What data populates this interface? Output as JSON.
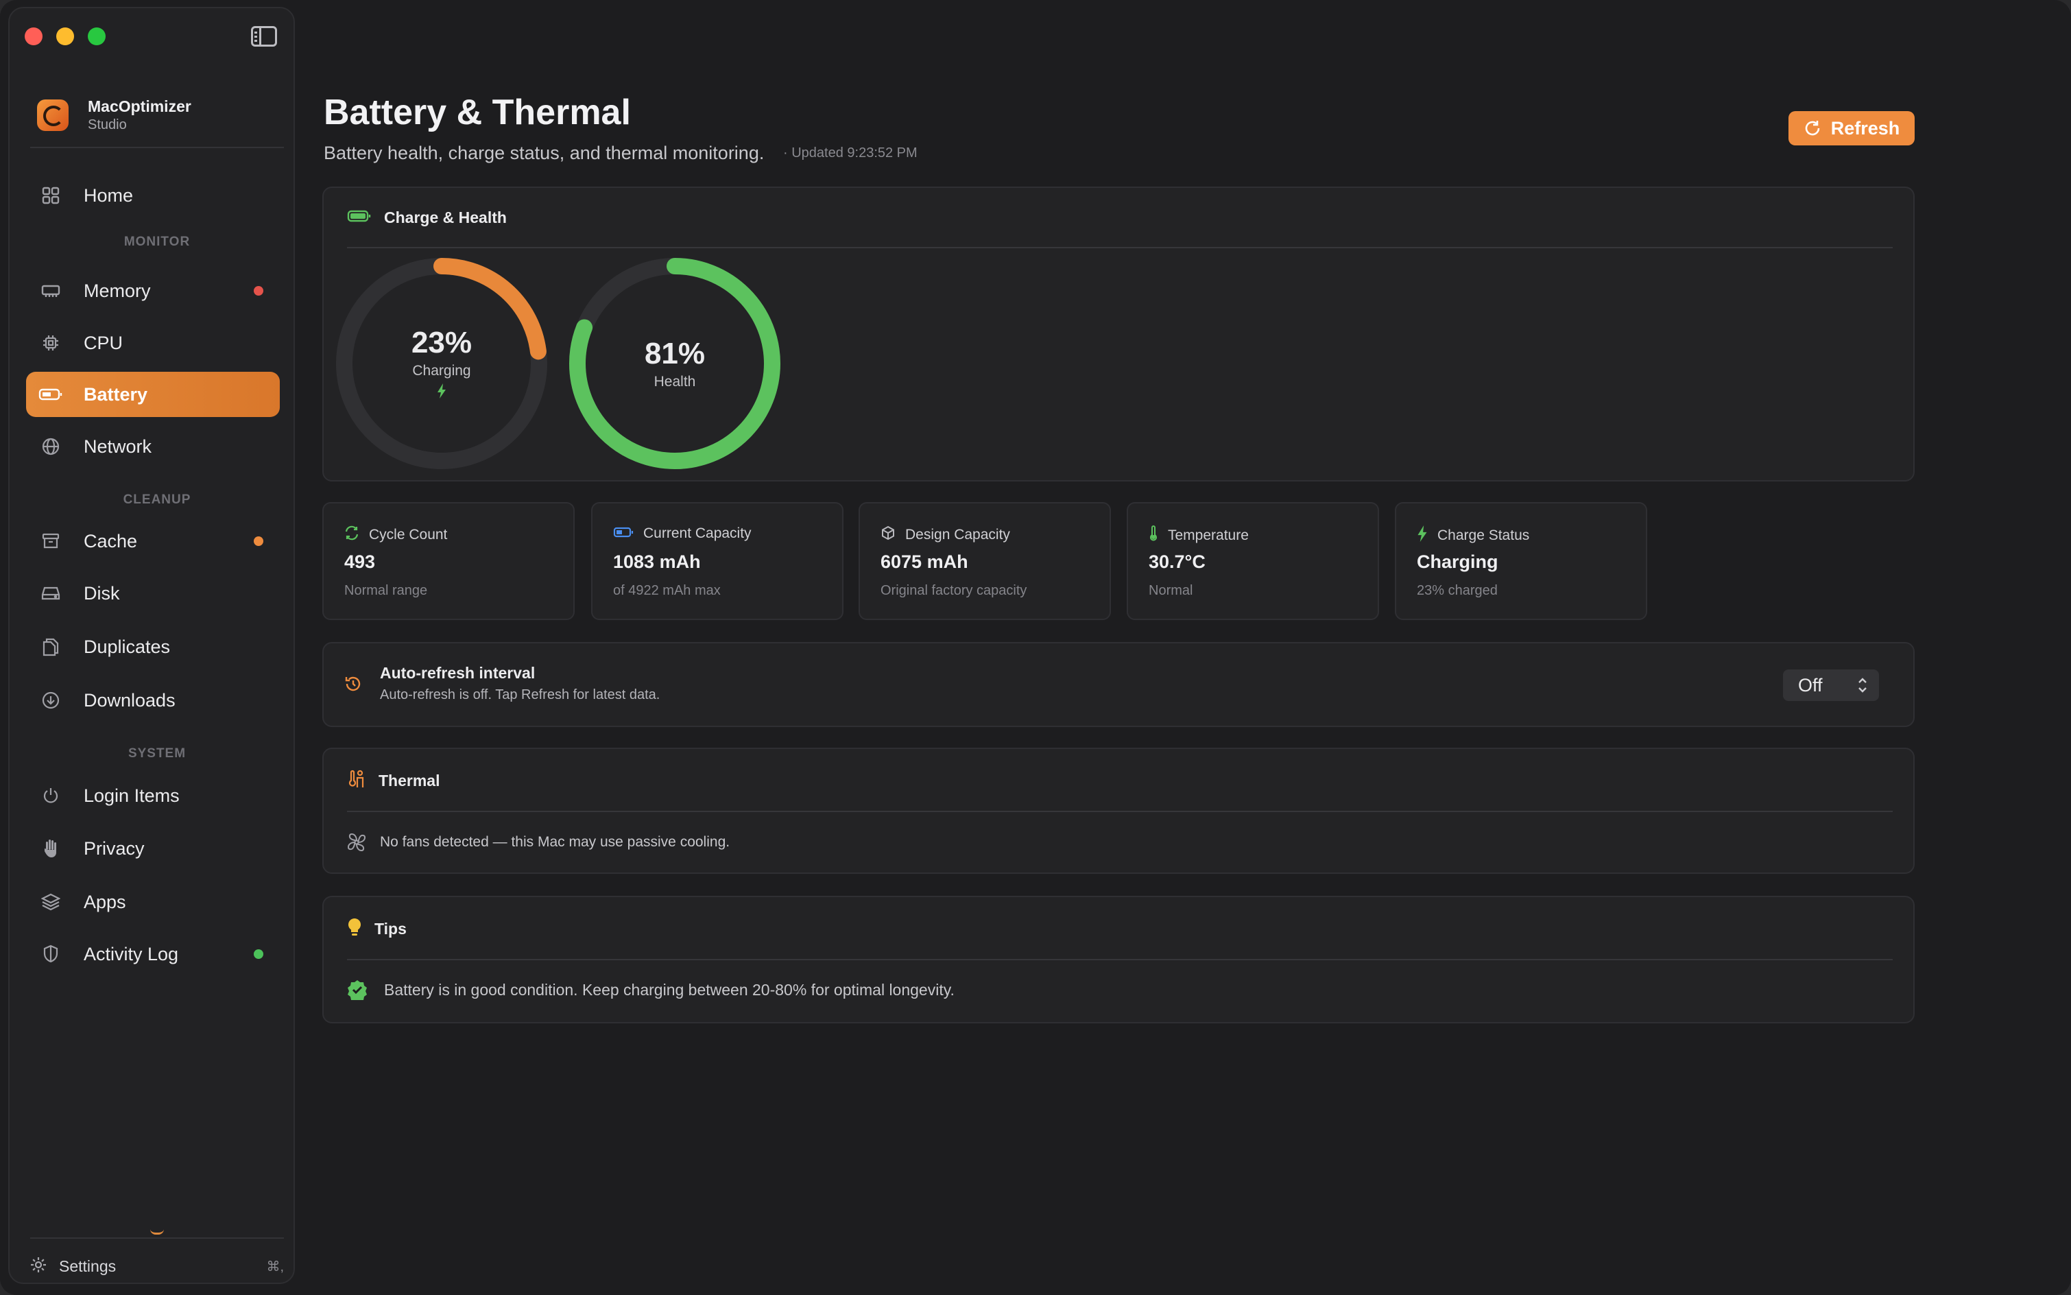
{
  "app": {
    "name": "MacOptimizer",
    "edition": "Studio"
  },
  "sidebar": {
    "home": "Home",
    "sections": {
      "monitor": "MONITOR",
      "cleanup": "CLEANUP",
      "system": "SYSTEM"
    },
    "items": {
      "memory": "Memory",
      "cpu": "CPU",
      "battery": "Battery",
      "network": "Network",
      "cache": "Cache",
      "disk": "Disk",
      "duplicates": "Duplicates",
      "downloads": "Downloads",
      "login_items": "Login Items",
      "privacy": "Privacy",
      "apps": "Apps",
      "activity_log": "Activity Log"
    },
    "active_item": "Battery",
    "settings_label": "Settings",
    "settings_shortcut": "⌘,",
    "status_colors": {
      "memory": "#e5534b",
      "cache": "#ef8c3e",
      "activity_log": "#4cc25a"
    }
  },
  "header": {
    "title": "Battery & Thermal",
    "subtitle": "Battery health, charge status, and thermal monitoring.",
    "updated": "· Updated 9:23:52 PM",
    "refresh_label": "Refresh"
  },
  "charge_health": {
    "title": "Charge & Health",
    "charge": {
      "percent_label": "23%",
      "value": 0.23,
      "label": "Charging",
      "color": "#e8883a"
    },
    "health": {
      "percent_label": "81%",
      "value": 0.81,
      "label": "Health",
      "color": "#5cc25e"
    }
  },
  "stats": [
    {
      "icon": "refresh-cycle-icon",
      "title": "Cycle Count",
      "value": "493",
      "note": "Normal range"
    },
    {
      "icon": "battery-icon",
      "title": "Current Capacity",
      "value": "1083 mAh",
      "note": "of 4922 mAh max"
    },
    {
      "icon": "cube-icon",
      "title": "Design Capacity",
      "value": "6075 mAh",
      "note": "Original factory capacity"
    },
    {
      "icon": "thermometer-icon",
      "title": "Temperature",
      "value": "30.7°C",
      "note": "Normal"
    },
    {
      "icon": "bolt-icon",
      "title": "Charge Status",
      "value": "Charging",
      "note": "23% charged"
    }
  ],
  "auto_refresh": {
    "title": "Auto-refresh interval",
    "description": "Auto-refresh is off. Tap Refresh for latest data.",
    "selected": "Off"
  },
  "thermal": {
    "title": "Thermal",
    "message": "No fans detected — this Mac may use passive cooling."
  },
  "tips": {
    "title": "Tips",
    "message": "Battery is in good condition. Keep charging between 20-80% for optimal longevity."
  },
  "colors": {
    "accent": "#ef8c3e",
    "success": "#5cc25e",
    "background": "#1d1d1f"
  }
}
